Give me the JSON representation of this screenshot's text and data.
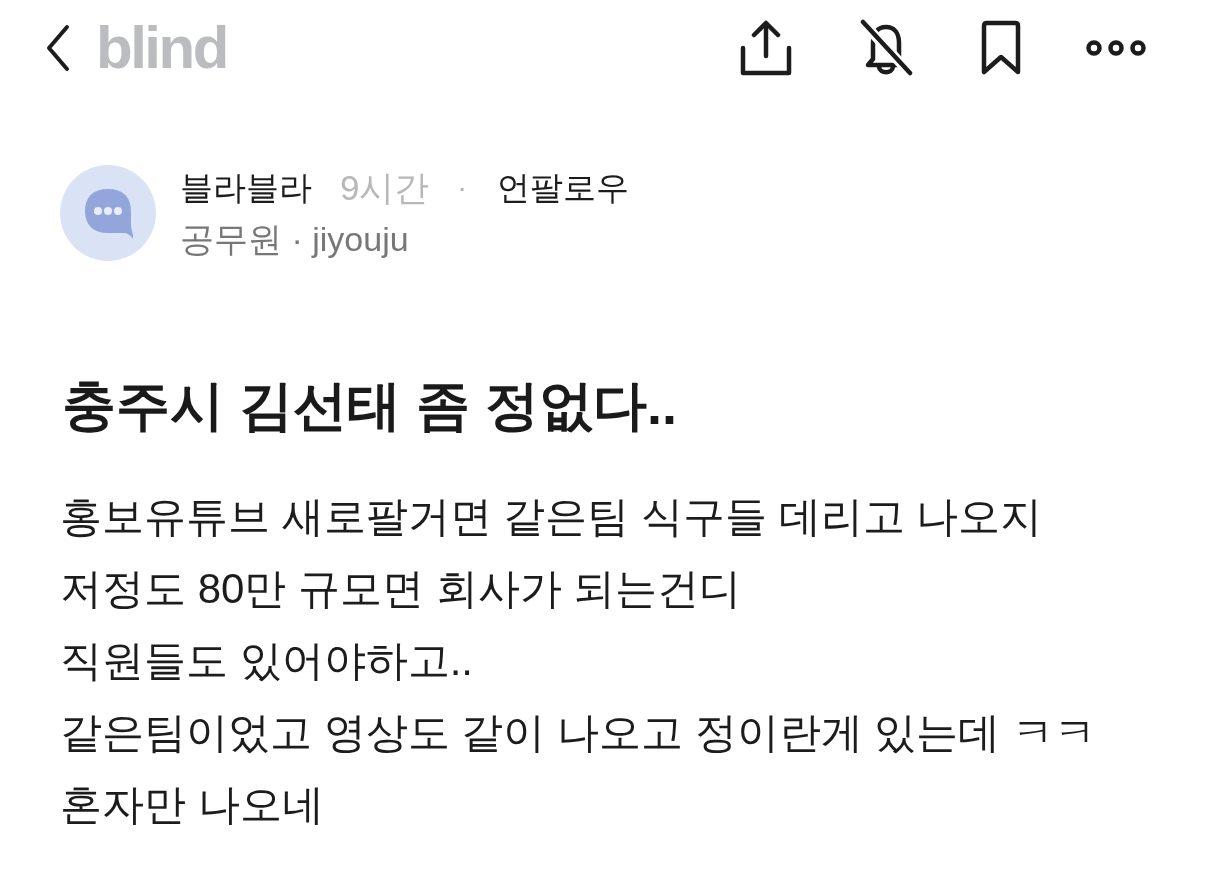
{
  "header": {
    "logo": "blind",
    "notifications_on": false,
    "bookmarked": false
  },
  "author": {
    "name": "블라블라",
    "time": "9시간",
    "separator": "·",
    "follow_button": "언팔로우",
    "affiliation": "공무원 · jiyouju"
  },
  "post": {
    "title": "충주시 김선태 좀 정없다..",
    "body": [
      "홍보유튜브 새로팔거면 같은팀 식구들 데리고 나오지",
      "저정도 80만 규모면 회사가 되는건디",
      "직원들도 있어야하고..",
      "같은팀이었고 영상도 같이 나오고 정이란게 있는데 ㅋㅋ",
      "혼자만 나오네"
    ]
  }
}
